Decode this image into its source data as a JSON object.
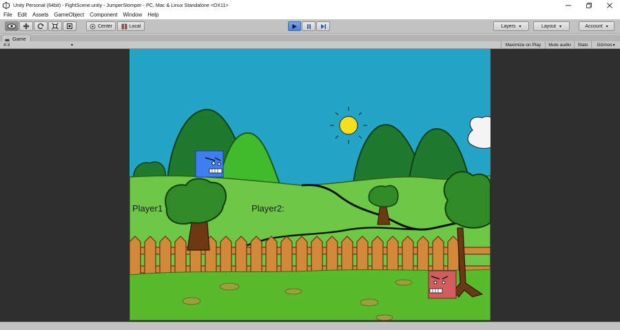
{
  "window": {
    "title": "Unity Personal (64bit) - FightScene.unity - JumperStomper - PC, Mac & Linux Standalone <DX11>",
    "controls": [
      "minimize",
      "restore",
      "close"
    ]
  },
  "menu": {
    "items": [
      "File",
      "Edit",
      "Assets",
      "GameObject",
      "Component",
      "Window",
      "Help"
    ]
  },
  "toolbar": {
    "tools": [
      "hand-tool",
      "move-tool",
      "rotate-tool",
      "scale-tool",
      "rect-tool"
    ],
    "pivot_label": "Center",
    "space_label": "Local",
    "play_controls": [
      "play",
      "pause",
      "step"
    ],
    "layers_label": "Layers",
    "layout_label": "Layout",
    "account_label": "Account"
  },
  "game_view": {
    "tab_label": "Game",
    "aspect": "4:3",
    "options": [
      "Maximize on Play",
      "Mute audio",
      "Stats",
      "Gizmos"
    ]
  },
  "scene": {
    "player1_label": "Player1",
    "player2_label": "Player2:",
    "colors": {
      "sky": "#24a4c6",
      "player1": "#3f7ef2",
      "player2": "#d15d5d",
      "grass": "#6cc845",
      "fence": "#d28a3a"
    }
  }
}
